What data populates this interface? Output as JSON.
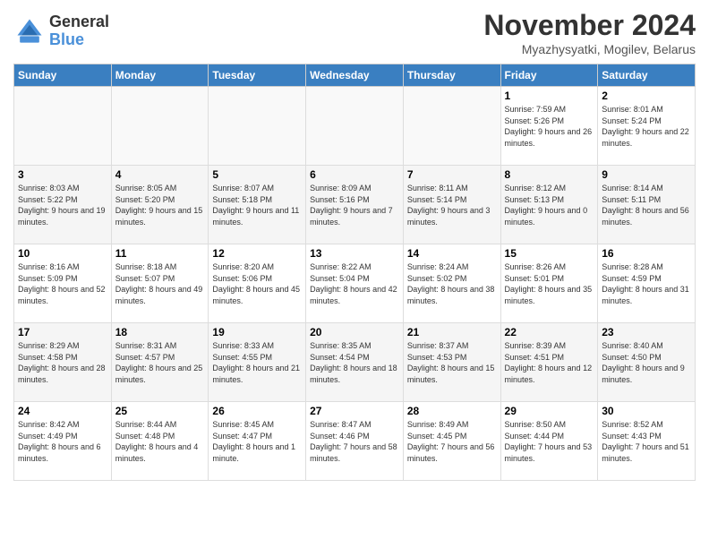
{
  "logo": {
    "general": "General",
    "blue": "Blue"
  },
  "title": "November 2024",
  "location": "Myazhysyatki, Mogilev, Belarus",
  "days_of_week": [
    "Sunday",
    "Monday",
    "Tuesday",
    "Wednesday",
    "Thursday",
    "Friday",
    "Saturday"
  ],
  "weeks": [
    [
      {
        "day": "",
        "info": ""
      },
      {
        "day": "",
        "info": ""
      },
      {
        "day": "",
        "info": ""
      },
      {
        "day": "",
        "info": ""
      },
      {
        "day": "",
        "info": ""
      },
      {
        "day": "1",
        "info": "Sunrise: 7:59 AM\nSunset: 5:26 PM\nDaylight: 9 hours and 26 minutes."
      },
      {
        "day": "2",
        "info": "Sunrise: 8:01 AM\nSunset: 5:24 PM\nDaylight: 9 hours and 22 minutes."
      }
    ],
    [
      {
        "day": "3",
        "info": "Sunrise: 8:03 AM\nSunset: 5:22 PM\nDaylight: 9 hours and 19 minutes."
      },
      {
        "day": "4",
        "info": "Sunrise: 8:05 AM\nSunset: 5:20 PM\nDaylight: 9 hours and 15 minutes."
      },
      {
        "day": "5",
        "info": "Sunrise: 8:07 AM\nSunset: 5:18 PM\nDaylight: 9 hours and 11 minutes."
      },
      {
        "day": "6",
        "info": "Sunrise: 8:09 AM\nSunset: 5:16 PM\nDaylight: 9 hours and 7 minutes."
      },
      {
        "day": "7",
        "info": "Sunrise: 8:11 AM\nSunset: 5:14 PM\nDaylight: 9 hours and 3 minutes."
      },
      {
        "day": "8",
        "info": "Sunrise: 8:12 AM\nSunset: 5:13 PM\nDaylight: 9 hours and 0 minutes."
      },
      {
        "day": "9",
        "info": "Sunrise: 8:14 AM\nSunset: 5:11 PM\nDaylight: 8 hours and 56 minutes."
      }
    ],
    [
      {
        "day": "10",
        "info": "Sunrise: 8:16 AM\nSunset: 5:09 PM\nDaylight: 8 hours and 52 minutes."
      },
      {
        "day": "11",
        "info": "Sunrise: 8:18 AM\nSunset: 5:07 PM\nDaylight: 8 hours and 49 minutes."
      },
      {
        "day": "12",
        "info": "Sunrise: 8:20 AM\nSunset: 5:06 PM\nDaylight: 8 hours and 45 minutes."
      },
      {
        "day": "13",
        "info": "Sunrise: 8:22 AM\nSunset: 5:04 PM\nDaylight: 8 hours and 42 minutes."
      },
      {
        "day": "14",
        "info": "Sunrise: 8:24 AM\nSunset: 5:02 PM\nDaylight: 8 hours and 38 minutes."
      },
      {
        "day": "15",
        "info": "Sunrise: 8:26 AM\nSunset: 5:01 PM\nDaylight: 8 hours and 35 minutes."
      },
      {
        "day": "16",
        "info": "Sunrise: 8:28 AM\nSunset: 4:59 PM\nDaylight: 8 hours and 31 minutes."
      }
    ],
    [
      {
        "day": "17",
        "info": "Sunrise: 8:29 AM\nSunset: 4:58 PM\nDaylight: 8 hours and 28 minutes."
      },
      {
        "day": "18",
        "info": "Sunrise: 8:31 AM\nSunset: 4:57 PM\nDaylight: 8 hours and 25 minutes."
      },
      {
        "day": "19",
        "info": "Sunrise: 8:33 AM\nSunset: 4:55 PM\nDaylight: 8 hours and 21 minutes."
      },
      {
        "day": "20",
        "info": "Sunrise: 8:35 AM\nSunset: 4:54 PM\nDaylight: 8 hours and 18 minutes."
      },
      {
        "day": "21",
        "info": "Sunrise: 8:37 AM\nSunset: 4:53 PM\nDaylight: 8 hours and 15 minutes."
      },
      {
        "day": "22",
        "info": "Sunrise: 8:39 AM\nSunset: 4:51 PM\nDaylight: 8 hours and 12 minutes."
      },
      {
        "day": "23",
        "info": "Sunrise: 8:40 AM\nSunset: 4:50 PM\nDaylight: 8 hours and 9 minutes."
      }
    ],
    [
      {
        "day": "24",
        "info": "Sunrise: 8:42 AM\nSunset: 4:49 PM\nDaylight: 8 hours and 6 minutes."
      },
      {
        "day": "25",
        "info": "Sunrise: 8:44 AM\nSunset: 4:48 PM\nDaylight: 8 hours and 4 minutes."
      },
      {
        "day": "26",
        "info": "Sunrise: 8:45 AM\nSunset: 4:47 PM\nDaylight: 8 hours and 1 minute."
      },
      {
        "day": "27",
        "info": "Sunrise: 8:47 AM\nSunset: 4:46 PM\nDaylight: 7 hours and 58 minutes."
      },
      {
        "day": "28",
        "info": "Sunrise: 8:49 AM\nSunset: 4:45 PM\nDaylight: 7 hours and 56 minutes."
      },
      {
        "day": "29",
        "info": "Sunrise: 8:50 AM\nSunset: 4:44 PM\nDaylight: 7 hours and 53 minutes."
      },
      {
        "day": "30",
        "info": "Sunrise: 8:52 AM\nSunset: 4:43 PM\nDaylight: 7 hours and 51 minutes."
      }
    ]
  ]
}
